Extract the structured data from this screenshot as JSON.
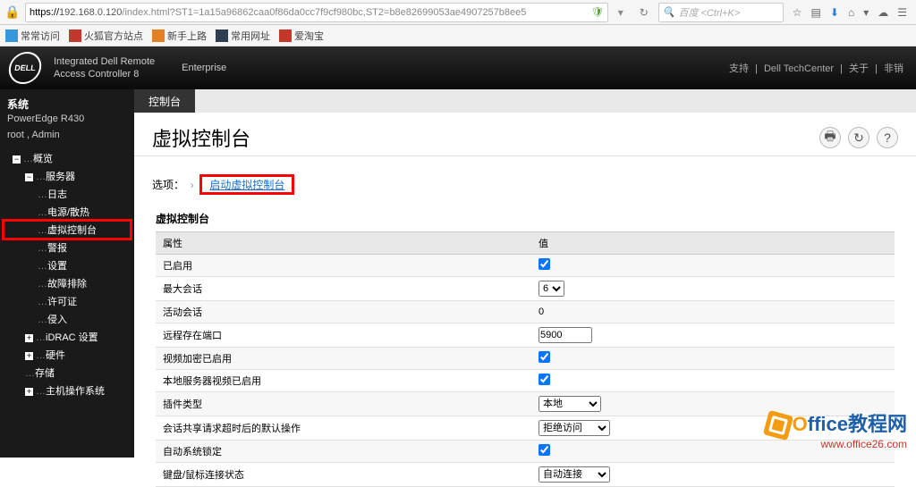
{
  "browser": {
    "url_host": "192.168.0.120",
    "url_rest": "/index.html?ST1=1a15a96862caa0f86da0cc7f9cf980bc,ST2=b8e82699053ae4907257b8ee5",
    "search_placeholder": "百度 <Ctrl+K>"
  },
  "bookmarks": {
    "label": "常常访问",
    "items": [
      "火狐官方站点",
      "新手上路",
      "常用网址",
      "爱淘宝"
    ]
  },
  "header": {
    "logo_text": "DELL",
    "title_line1": "Integrated Dell Remote",
    "title_line2": "Access Controller 8",
    "enterprise": "Enterprise",
    "link_support": "支持",
    "link_techcenter": "Dell TechCenter",
    "link_about": "关于",
    "link_logout": "非销"
  },
  "sidebar": {
    "system": "系统",
    "model": "PowerEdge R430",
    "user": "root , Admin",
    "tree": {
      "overview": "概览",
      "server": "服务器",
      "logs": "日志",
      "power": "电源/散热",
      "vconsole": "虚拟控制台",
      "alerts": "警报",
      "settings": "设置",
      "troubleshoot": "故障排除",
      "license": "许可证",
      "intrude": "侵入",
      "idrac": "iDRAC 设置",
      "hardware": "硬件",
      "storage": "存储",
      "hostos": "主机操作系统"
    }
  },
  "content": {
    "tab_label": "控制台",
    "page_title": "虚拟控制台",
    "options_label": "选项：",
    "launch_link": "启动虚拟控制台",
    "section_title": "虚拟控制台",
    "col_attr": "属性",
    "col_val": "值",
    "rows": {
      "enabled": "已启用",
      "max_sessions": "最大会话",
      "max_sessions_val": "6",
      "active_sessions": "活动会话",
      "active_sessions_val": "0",
      "remote_port": "远程存在端口",
      "remote_port_val": "5900",
      "video_enc": "视频加密已启用",
      "local_video": "本地服务器视频已启用",
      "plugin_type": "插件类型",
      "plugin_type_val": "本地",
      "share_timeout": "会话共享请求超时后的默认操作",
      "share_timeout_val": "拒绝访问",
      "auto_lock": "自动系统锁定",
      "kbd_state": "键盘/鼠标连接状态",
      "kbd_state_val": "自动连接"
    }
  },
  "watermark": {
    "text_main": "Office教程网",
    "text_url": "www.office26.com"
  }
}
